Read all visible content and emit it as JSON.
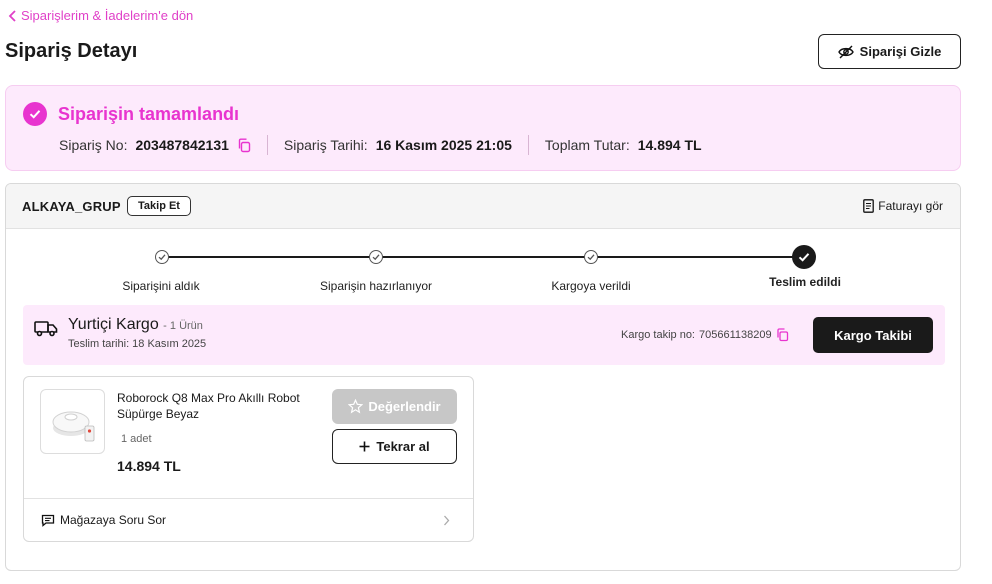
{
  "header": {
    "back_label": "Siparişlerim & İadelerim'e dön",
    "title": "Sipariş Detayı",
    "hide_button": "Siparişi Gizle"
  },
  "status": {
    "title": "Siparişin tamamlandı",
    "order_no_label": "Sipariş No:",
    "order_no": "203487842131",
    "order_date_label": "Sipariş Tarihi:",
    "order_date": "16 Kasım 2025 21:05",
    "total_label": "Toplam Tutar:",
    "total": "14.894 TL"
  },
  "seller": {
    "name": "ALKAYA_GRUP",
    "follow_label": "Takip Et",
    "invoice_label": "Faturayı gör"
  },
  "steps": [
    {
      "label": "Siparişini aldık",
      "done": true
    },
    {
      "label": "Siparişin hazırlanıyor",
      "done": true
    },
    {
      "label": "Kargoya verildi",
      "done": true
    },
    {
      "label": "Teslim edildi",
      "done": true,
      "active": true
    }
  ],
  "shipping": {
    "carrier": "Yurtiçi Kargo",
    "count": "- 1 Ürün",
    "delivery_date": "Teslim tarihi: 18 Kasım 2025",
    "tracking_label": "Kargo takip no:",
    "tracking_no": "705661138209",
    "track_button": "Kargo Takibi"
  },
  "product": {
    "name": "Roborock Q8 Max Pro Akıllı Robot Süpürge Beyaz",
    "quantity": "1 adet",
    "price": "14.894 TL",
    "rate_button": "Değerlendir",
    "rebuy_button": "Tekrar al",
    "ask_store": "Mağazaya Soru Sor"
  },
  "colors": {
    "accent": "#e834cf",
    "status_bg": "#fdeafc",
    "dark": "#1a1a1a",
    "disabled": "#c7c7c7"
  },
  "icons": {
    "back": "chevron-left-icon",
    "hide": "eye-off-icon",
    "check": "check-circle-icon",
    "copy": "copy-icon",
    "invoice": "document-icon",
    "truck": "truck-icon",
    "star": "star-icon",
    "plus": "plus-icon",
    "chat": "chat-icon",
    "chevron": "chevron-right-icon"
  }
}
